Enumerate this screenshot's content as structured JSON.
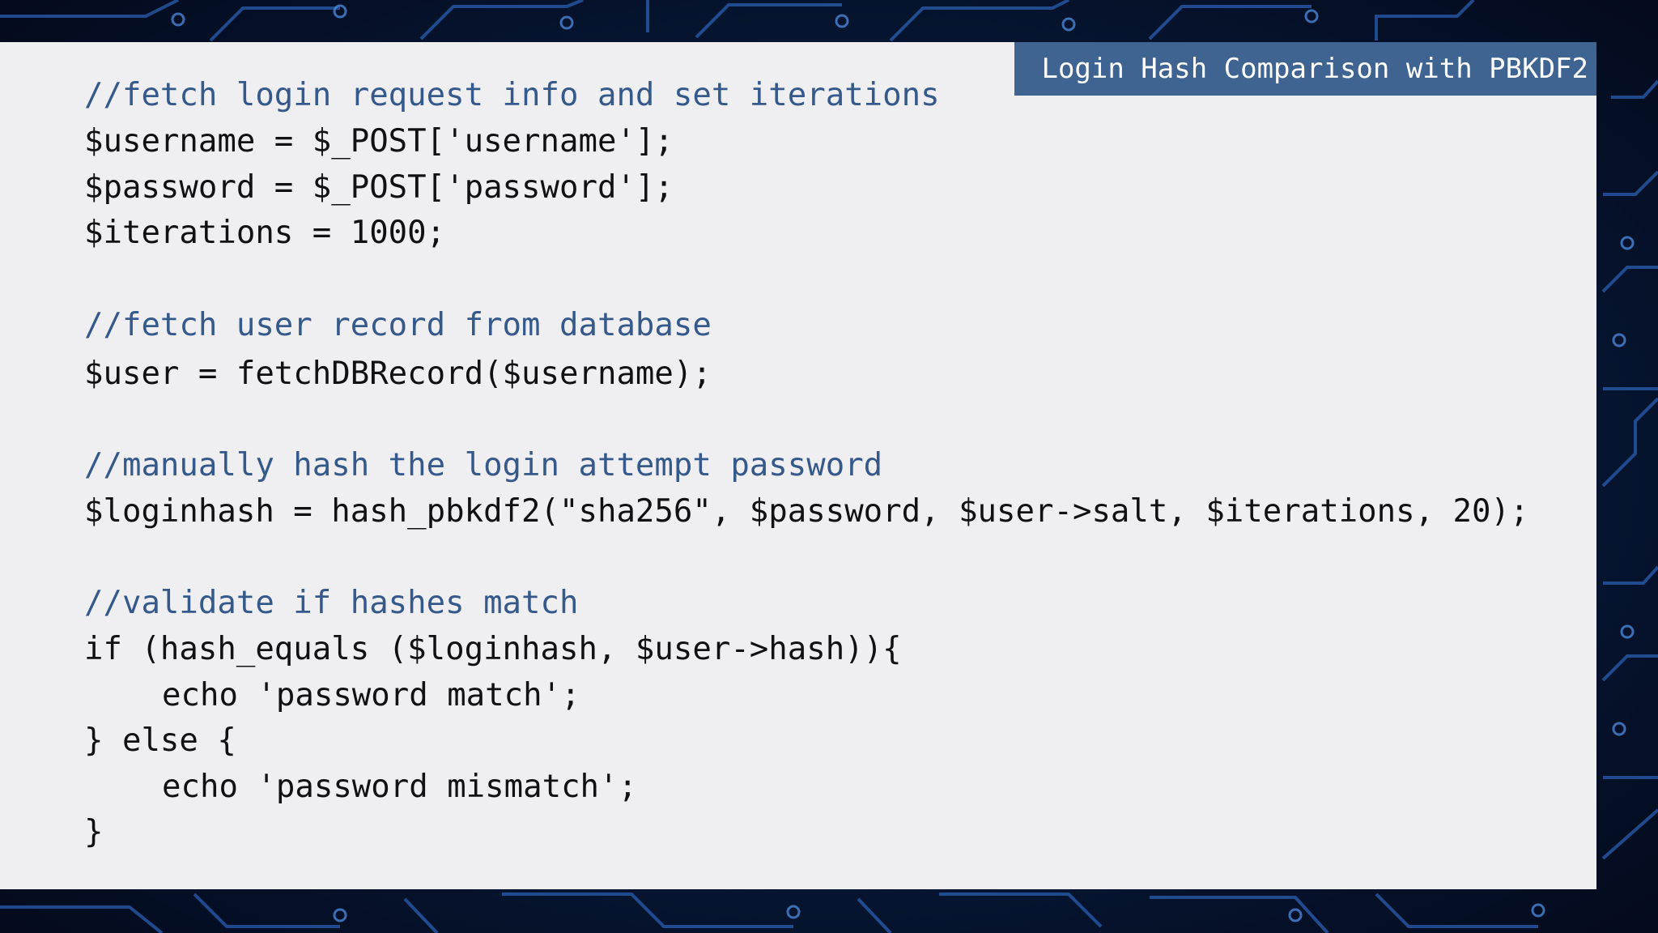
{
  "slide": {
    "title": "Login Hash Comparison with PBKDF2"
  },
  "code": {
    "lines": [
      "//fetch login request info and set iterations",
      "$username = $_POST['username'];",
      "$password = $_POST['password'];",
      "$iterations = 1000;",
      "//fetch user record from database",
      "$user = fetchDBRecord($username);",
      "//manually hash the login attempt password",
      "$loginhash = hash_pbkdf2(\"sha256\", $password, $user->salt, $iterations, 20);",
      "//validate if hashes match",
      "if (hash_equals ($loginhash, $user->hash)){",
      "echo 'password match';",
      "} else {",
      "echo 'password mismatch';",
      "}"
    ]
  },
  "colors": {
    "panel_background": "#efeef1",
    "title_tab": "#3f6492",
    "comment": "#35598a",
    "code_text": "#111111",
    "page_background": "#06122e"
  },
  "icons": {
    "background": "circuit-board-pattern"
  }
}
